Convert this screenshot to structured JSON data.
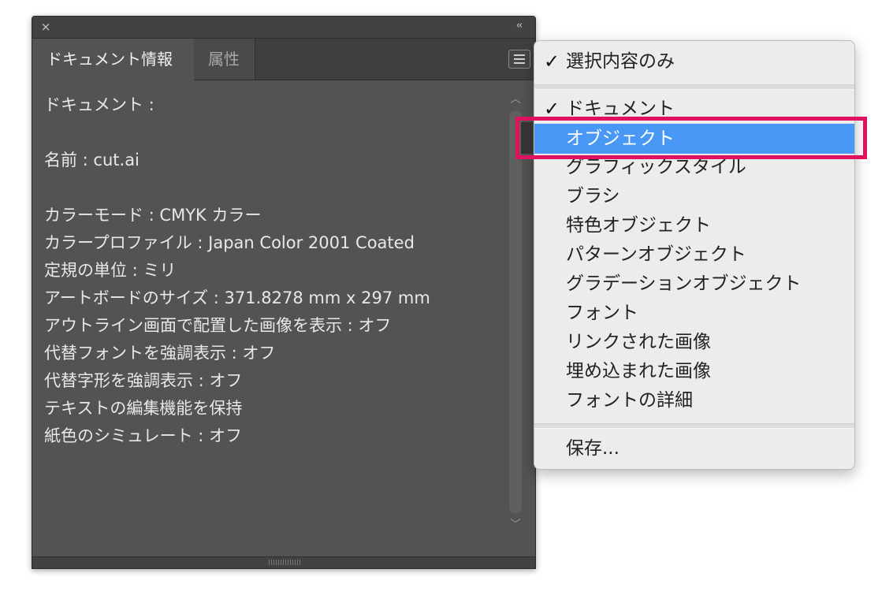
{
  "panel": {
    "close_glyph": "×",
    "collapse_glyph": "‹‹",
    "tabs": [
      {
        "label": "ドキュメント情報"
      },
      {
        "label": "属性"
      }
    ],
    "content_lines": [
      "ドキュメント :",
      "",
      "名前 : cut.ai",
      "",
      "カラーモード : CMYK カラー",
      "カラープロファイル : Japan Color 2001 Coated",
      "定規の単位 : ミリ",
      "アートボードのサイズ : 371.8278 mm x 297 mm",
      "アウトライン画面で配置した画像を表示 : オフ",
      "代替フォントを強調表示 : オフ",
      "代替字形を強調表示 : オフ",
      "テキストの編集機能を保持",
      "紙色のシミュレート : オフ"
    ],
    "scroll_up_glyph": "︿",
    "scroll_down_glyph": "﹀"
  },
  "menu": {
    "check_glyph": "✓",
    "items": [
      {
        "label": "選択内容のみ",
        "checked": true
      },
      {
        "label": "ドキュメント",
        "checked": true
      },
      {
        "label": "オブジェクト",
        "selected": true
      },
      {
        "label": "グラフィックスタイル"
      },
      {
        "label": "ブラシ"
      },
      {
        "label": "特色オブジェクト"
      },
      {
        "label": "パターンオブジェクト"
      },
      {
        "label": "グラデーションオブジェクト"
      },
      {
        "label": "フォント"
      },
      {
        "label": "リンクされた画像"
      },
      {
        "label": "埋め込まれた画像"
      },
      {
        "label": "フォントの詳細"
      },
      {
        "label": "保存..."
      }
    ]
  },
  "colors": {
    "panel_bg": "#535353",
    "menu_bg": "#ececec",
    "selection": "#4a98f5",
    "highlight_frame": "#e0115f"
  }
}
